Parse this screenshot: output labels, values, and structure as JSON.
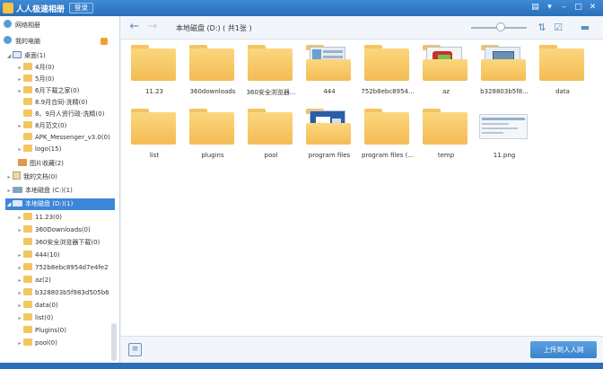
{
  "window": {
    "title": "人人极速相册",
    "login_label": "登录",
    "controls": [
      "menu-icon",
      "skin-icon",
      "minimize-icon",
      "maximize-icon",
      "close-icon"
    ]
  },
  "sidebar": {
    "sections": [
      {
        "label": "网络相册"
      },
      {
        "label": "我的电脑"
      }
    ],
    "tree": [
      {
        "label": "桌面(1)",
        "icon": "pc-icon",
        "expanded": true
      },
      {
        "label": "4月(0)"
      },
      {
        "label": "5月(0)"
      },
      {
        "label": "6月下载之家(0)"
      },
      {
        "label": "8.9月合同-洗精(0)"
      },
      {
        "label": "8、9月人资行政-洗精(0)"
      },
      {
        "label": "8月范文(0)"
      },
      {
        "label": "APK_Messenger_v3.0(0)"
      },
      {
        "label": "logo(15)"
      },
      {
        "label": "图片收藏(2)"
      },
      {
        "label": "我的文档(0)"
      },
      {
        "label": "本地磁盘 (C:)(1)"
      },
      {
        "label": "本地磁盘 (D:)(1)",
        "selected": true
      },
      {
        "label": "11.23(0)"
      },
      {
        "label": "360Downloads(0)"
      },
      {
        "label": "360安全浏览器下载(0)"
      },
      {
        "label": "444(10)"
      },
      {
        "label": "752b8ebc8954d7e4fe2"
      },
      {
        "label": "az(2)"
      },
      {
        "label": "b328803b5f983d505b6"
      },
      {
        "label": "data(0)"
      },
      {
        "label": "list(0)"
      },
      {
        "label": "Plugins(0)"
      },
      {
        "label": "pool(0)"
      }
    ]
  },
  "toolbar": {
    "back": "←",
    "forward": "→",
    "path": "本地磁盘 (D:) ( 共1张 )",
    "sort_icon": "sort-icon",
    "select_icon": "select-icon",
    "delete_icon": "trash-icon"
  },
  "grid": {
    "items": [
      {
        "label": "11.23",
        "type": "folder"
      },
      {
        "label": "360downloads",
        "type": "folder"
      },
      {
        "label": "360安全浏览器...",
        "type": "folder"
      },
      {
        "label": "444",
        "type": "folder-preview",
        "preview": "screenshot"
      },
      {
        "label": "752b8ebc8954...",
        "type": "folder"
      },
      {
        "label": "az",
        "type": "folder-preview",
        "preview": "installer"
      },
      {
        "label": "b328803b5f8...",
        "type": "folder-preview",
        "preview": "monitor"
      },
      {
        "label": "data",
        "type": "folder"
      },
      {
        "label": "list",
        "type": "folder"
      },
      {
        "label": "plugins",
        "type": "folder"
      },
      {
        "label": "pool",
        "type": "folder"
      },
      {
        "label": "program files",
        "type": "folder-preview",
        "preview": "word"
      },
      {
        "label": "program files (...",
        "type": "folder"
      },
      {
        "label": "temp",
        "type": "folder"
      },
      {
        "label": "11.png",
        "type": "image"
      }
    ]
  },
  "footer": {
    "upload_label": "上传到人人网"
  }
}
